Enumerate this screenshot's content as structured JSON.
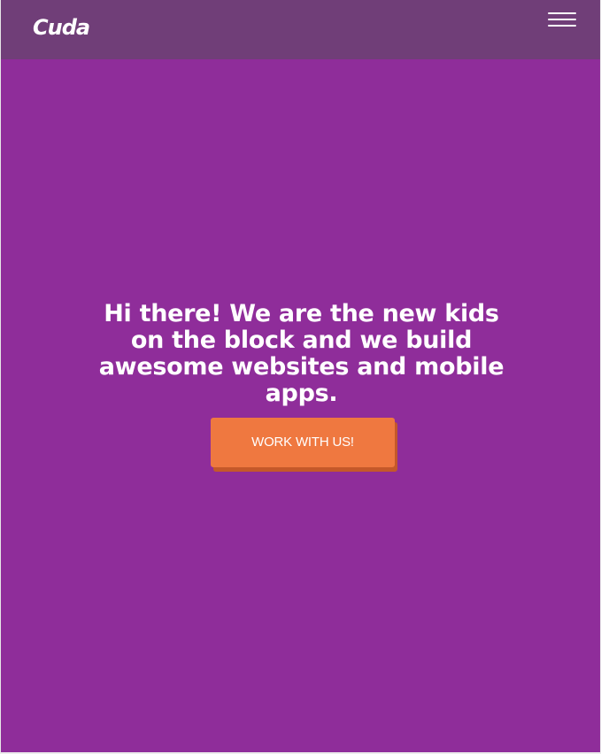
{
  "navbar": {
    "brand": "Cuda",
    "menu_icon": "hamburger-menu-icon"
  },
  "hero": {
    "headline": "Hi there! We are the new kids on the block and we build awesome websites and mobile apps.",
    "cta_label": "WORK WITH US!"
  },
  "colors": {
    "navbar_background": "#703e78",
    "hero_background": "#8f2d9a",
    "cta_background": "#ef7840",
    "cta_shadow": "#c4582a",
    "text": "#ffffff"
  }
}
